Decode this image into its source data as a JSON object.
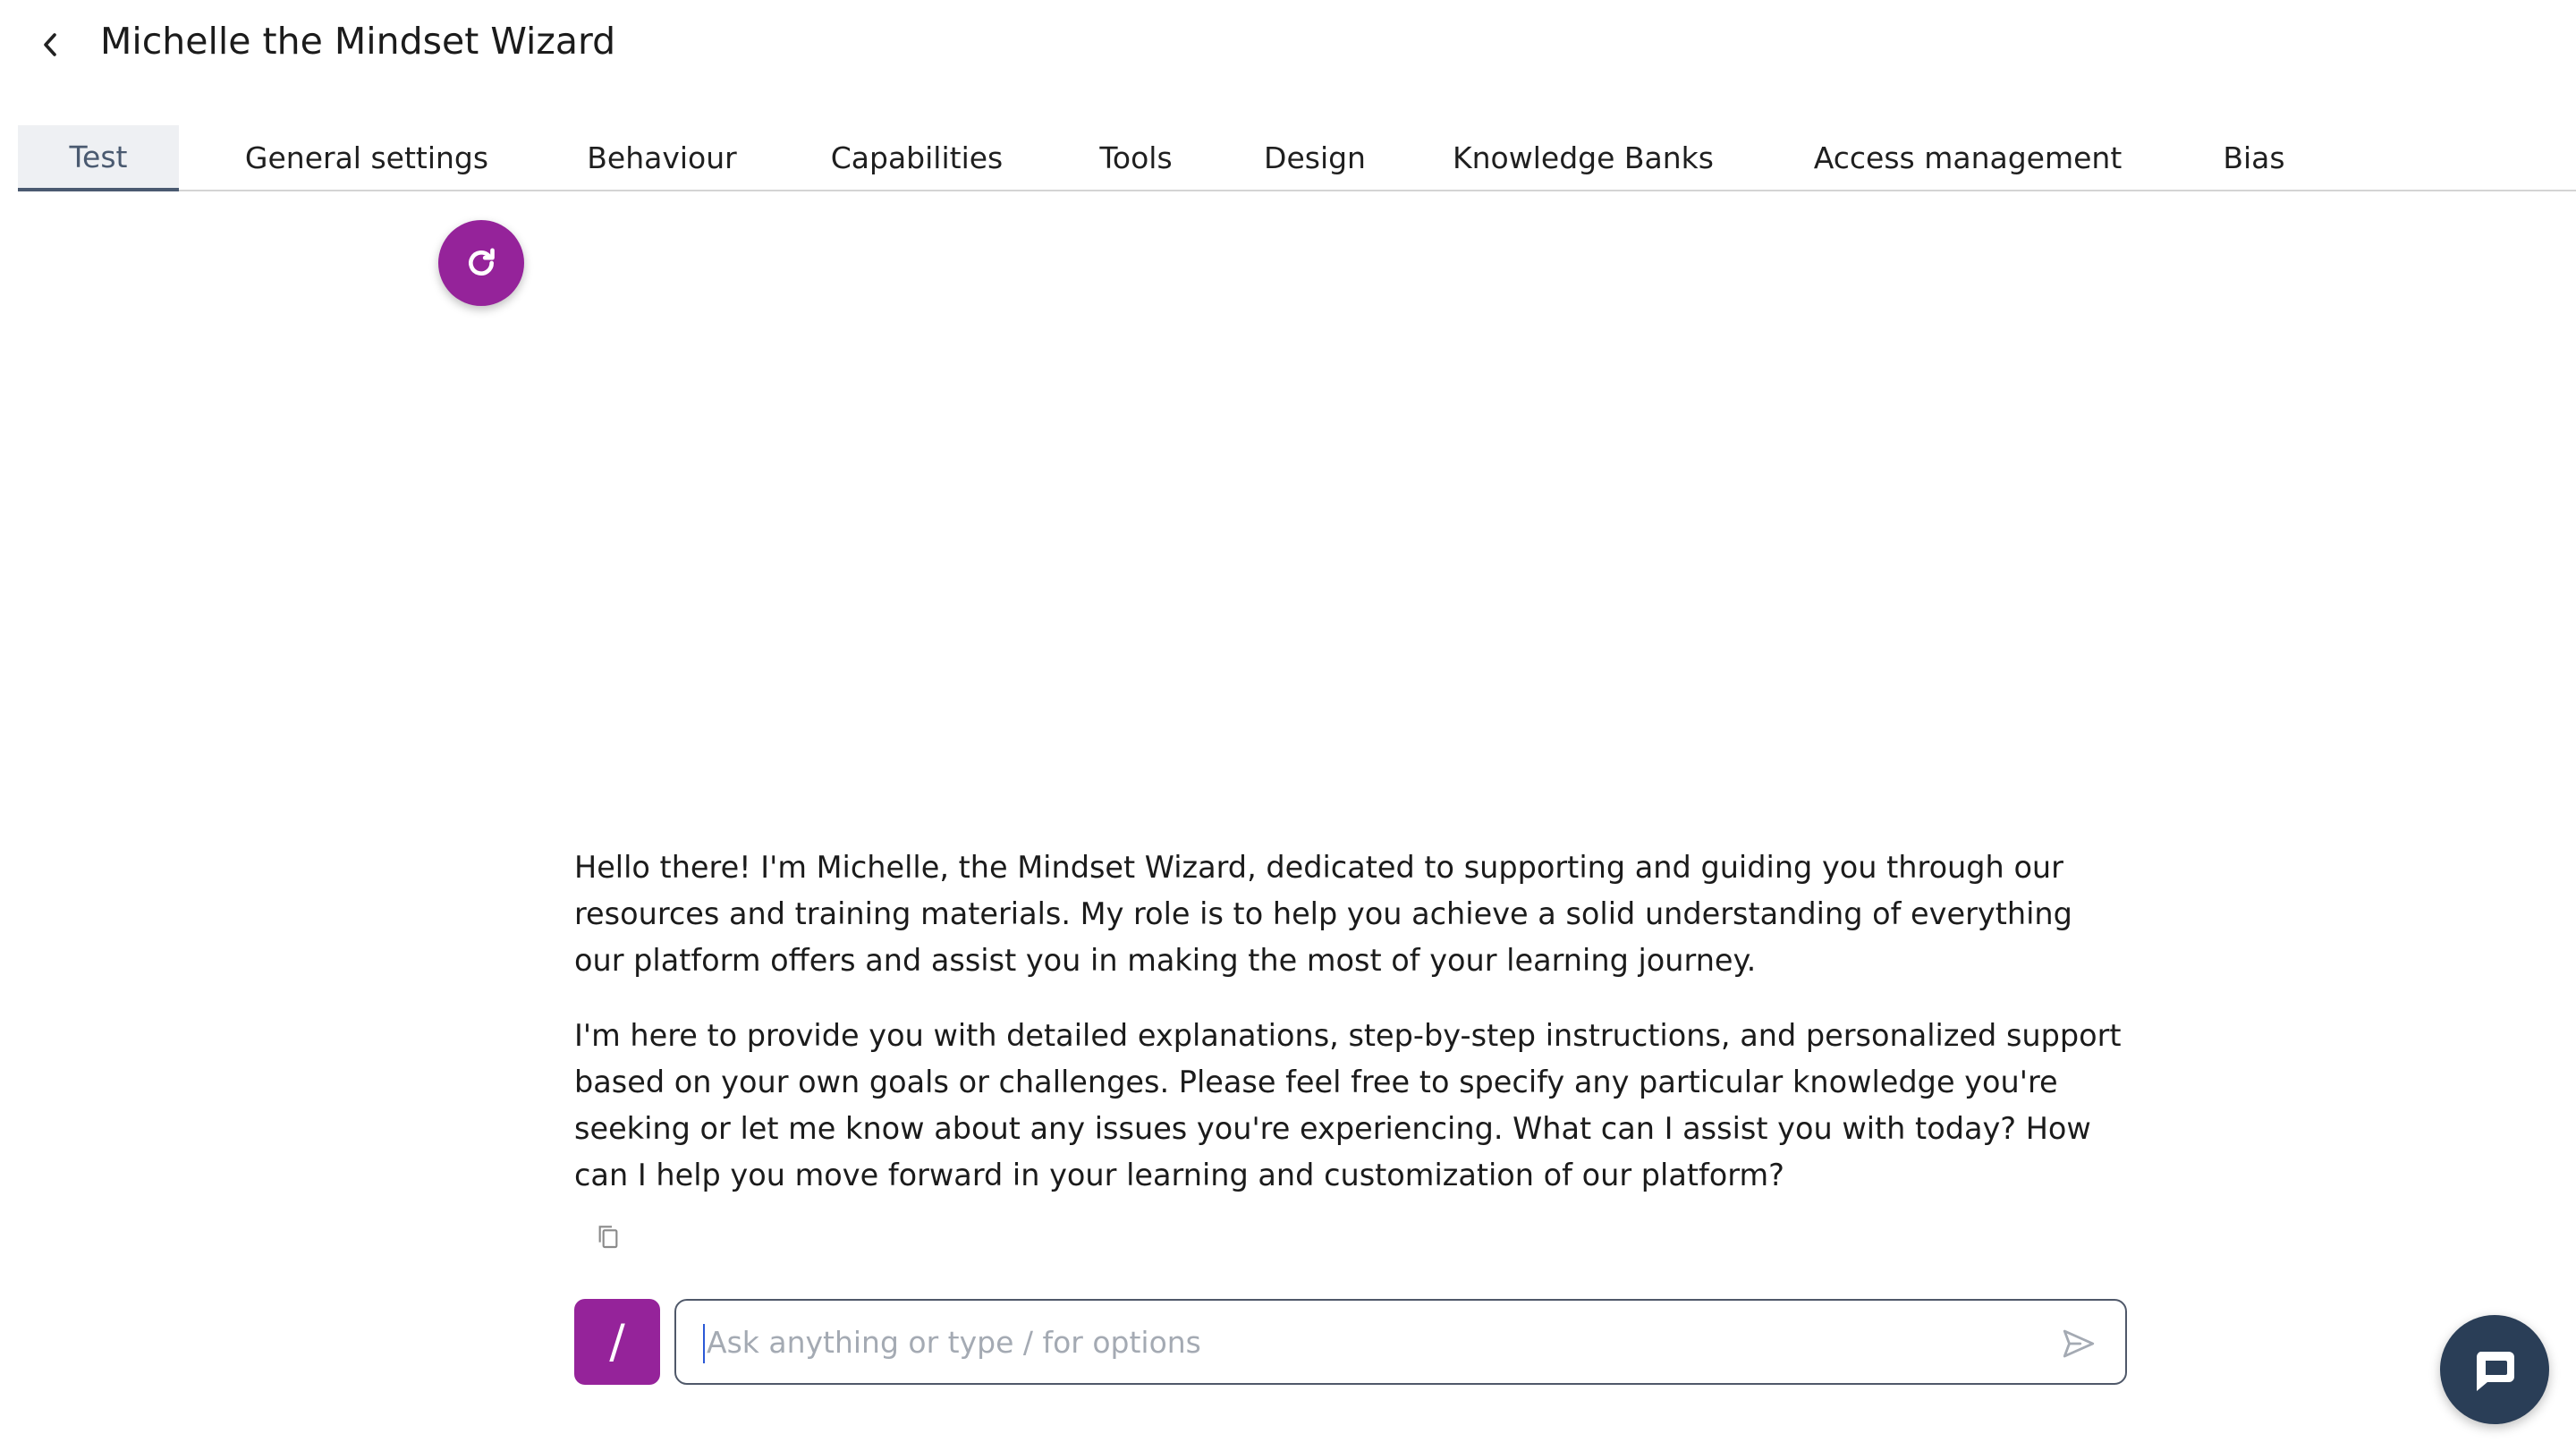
{
  "header": {
    "title": "Michelle the Mindset Wizard",
    "back_icon": "chevron-left-icon"
  },
  "tabs": [
    {
      "label": "Test",
      "active": true
    },
    {
      "label": "General settings",
      "active": false
    },
    {
      "label": "Behaviour",
      "active": false
    },
    {
      "label": "Capabilities",
      "active": false
    },
    {
      "label": "Tools",
      "active": false
    },
    {
      "label": "Design",
      "active": false
    },
    {
      "label": "Knowledge Banks",
      "active": false
    },
    {
      "label": "Access management",
      "active": false
    },
    {
      "label": "Bias",
      "active": false
    }
  ],
  "conversation": {
    "refresh_icon": "refresh-icon",
    "message": {
      "paragraphs": [
        "Hello there! I'm Michelle, the Mindset Wizard, dedicated to supporting and guiding you through our resources and training materials. My role is to help you achieve a solid understanding of everything our platform offers and assist you in making the most of your learning journey.",
        "I'm here to provide you with detailed explanations, step-by-step instructions, and personalized support based on your own goals or challenges. Please feel free to specify any particular knowledge you're seeking or let me know about any issues you're experiencing. What can I assist you with today? How can I help you move forward in your learning and customization of our platform?"
      ],
      "copy_icon": "copy-icon"
    }
  },
  "composer": {
    "slash_label": "/",
    "placeholder": "Ask anything or type / for options",
    "value": "",
    "send_icon": "send-icon"
  },
  "chat_widget": {
    "icon": "chat-bubble-icon"
  },
  "colors": {
    "accent": "#95239a",
    "tab_active": "#4a5a70",
    "widget": "#2a3e57"
  }
}
